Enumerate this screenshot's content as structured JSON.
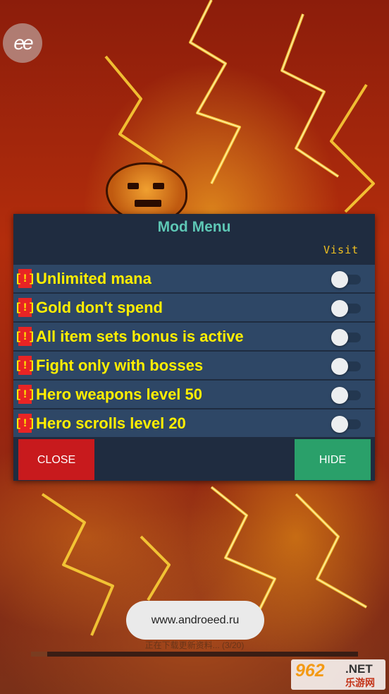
{
  "app": {
    "logo_text": "ee"
  },
  "mod_menu": {
    "title": "Mod Menu",
    "marquee_text": "Visit",
    "warning_badge": "[!]",
    "features": [
      {
        "label": "Unlimited mana",
        "enabled": false
      },
      {
        "label": "Gold don't spend",
        "enabled": false
      },
      {
        "label": "All item sets bonus is active",
        "enabled": false
      },
      {
        "label": "Fight only with bosses",
        "enabled": false
      },
      {
        "label": "Hero weapons level 50",
        "enabled": false
      },
      {
        "label": "Hero scrolls level 20",
        "enabled": false
      }
    ],
    "close_label": "CLOSE",
    "hide_label": "HIDE"
  },
  "toast": {
    "text": "www.androeed.ru"
  },
  "loading": {
    "text": "正在下载更新资料... (3/20)",
    "progress": 0.05
  },
  "watermark": {
    "number": "962",
    "net": ".NET",
    "cn": "乐游网"
  },
  "colors": {
    "panel_bg": "#1f2c40",
    "row_bg": "#2e4766",
    "title": "#5ec7b5",
    "feature_text": "#ffee00",
    "warning_bg": "#e82424",
    "close_btn": "#c81a1d",
    "hide_btn": "#2aa06a"
  }
}
